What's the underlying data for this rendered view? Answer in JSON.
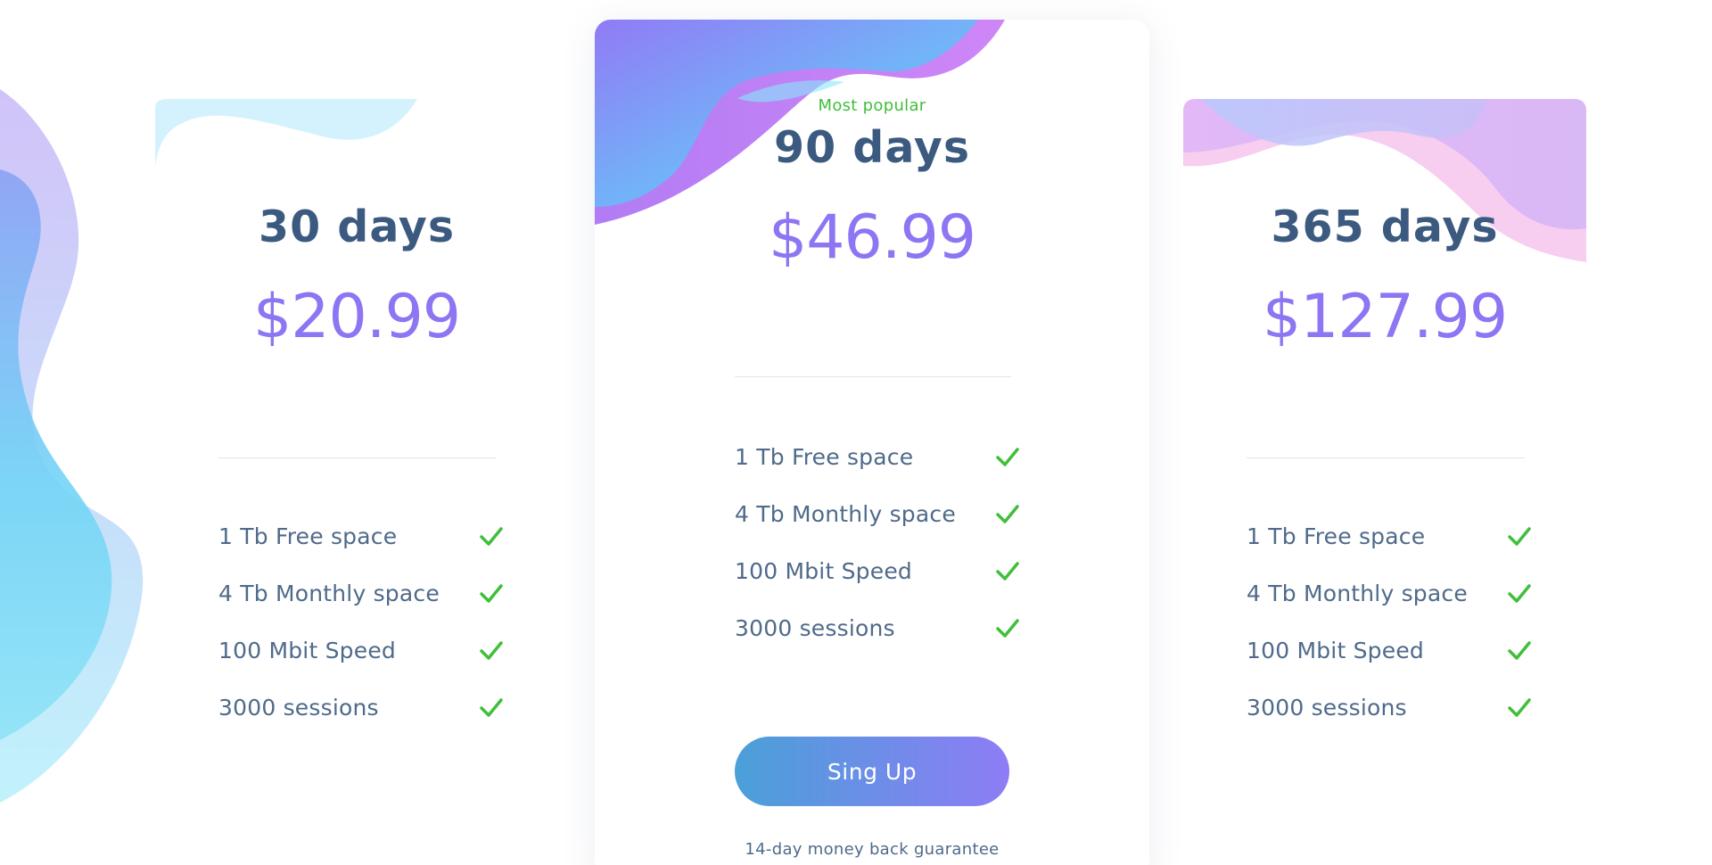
{
  "plans": [
    {
      "title": "30 days",
      "price": "$20.99",
      "features": [
        "1 Tb Free space",
        "4 Tb Monthly space",
        "100 Mbit Speed",
        "3000 sessions"
      ]
    },
    {
      "badge": "Most popular",
      "title": "90 days",
      "price": "$46.99",
      "features": [
        "1 Tb Free space",
        "4 Tb Monthly space",
        "100 Mbit Speed",
        "3000 sessions"
      ],
      "cta_label": "Sing Up",
      "guarantee": "14-day money back guarantee"
    },
    {
      "title": "365 days",
      "price": "$127.99",
      "features": [
        "1 Tb Free space",
        "4 Tb Monthly space",
        "100 Mbit Speed",
        "3000 sessions"
      ]
    }
  ],
  "icons": {
    "feature_check": "check-icon"
  },
  "colors": {
    "title": "#3c5a80",
    "price": "#8d75f3",
    "badge": "#3fbf3a",
    "check": "#3fbf3a",
    "feature_text": "#4f6a8a",
    "button_gradient_start": "#4aa0d8",
    "button_gradient_end": "#8e7cf6"
  }
}
